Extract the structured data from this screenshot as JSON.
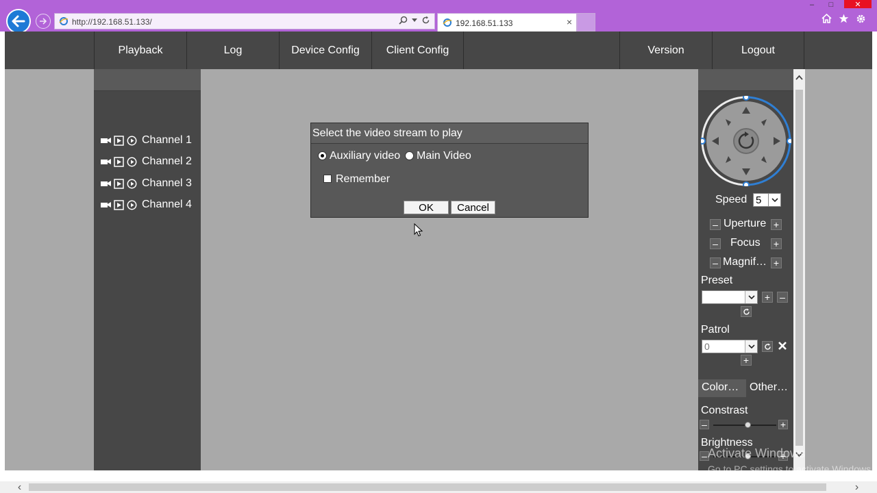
{
  "browser": {
    "url": "http://192.168.51.133/",
    "tab_title": "192.168.51.133",
    "tab_close": "×",
    "window_controls": {
      "minimize": "–",
      "maximize": "□",
      "close": "✕"
    },
    "icons": [
      "back-icon",
      "forward-icon",
      "search-icon",
      "dropdown-icon",
      "refresh-icon",
      "home-icon",
      "favorites-star-icon",
      "gear-icon"
    ]
  },
  "topnav": {
    "items": [
      "Playback",
      "Log",
      "Device Config",
      "Client Config",
      "Version",
      "Logout"
    ]
  },
  "channels": [
    {
      "label": "Channel 1"
    },
    {
      "label": "Channel 2"
    },
    {
      "label": "Channel 3"
    },
    {
      "label": "Channel 4"
    }
  ],
  "ptz": {
    "speed_label": "Speed",
    "speed_value": "5",
    "uperture_label": "Uperture",
    "focus_label": "Focus",
    "magnify_label": "Magnif…",
    "preset_label": "Preset",
    "patrol_label": "Patrol",
    "patrol_value": "0",
    "tabs": [
      "Color…",
      "Other…"
    ],
    "contrast_label": "Constrast",
    "brightness_label": "Brightness",
    "contrast_level": 0.55,
    "brightness_level": 0.55
  },
  "dialog": {
    "title": "Select the video stream to play",
    "option_aux": "Auxiliary video",
    "option_main": "Main Video",
    "remember": "Remember",
    "ok": "OK",
    "cancel": "Cancel",
    "selected": "Auxiliary video"
  },
  "watermark": {
    "line1": "Activate Windows",
    "line2": "Go to PC settings to activate Windows."
  },
  "colors": {
    "chrome": "#b263d8",
    "panel": "#474747",
    "page_bg": "#a9a9a9",
    "ptz_ring": "#2f7fd4"
  }
}
